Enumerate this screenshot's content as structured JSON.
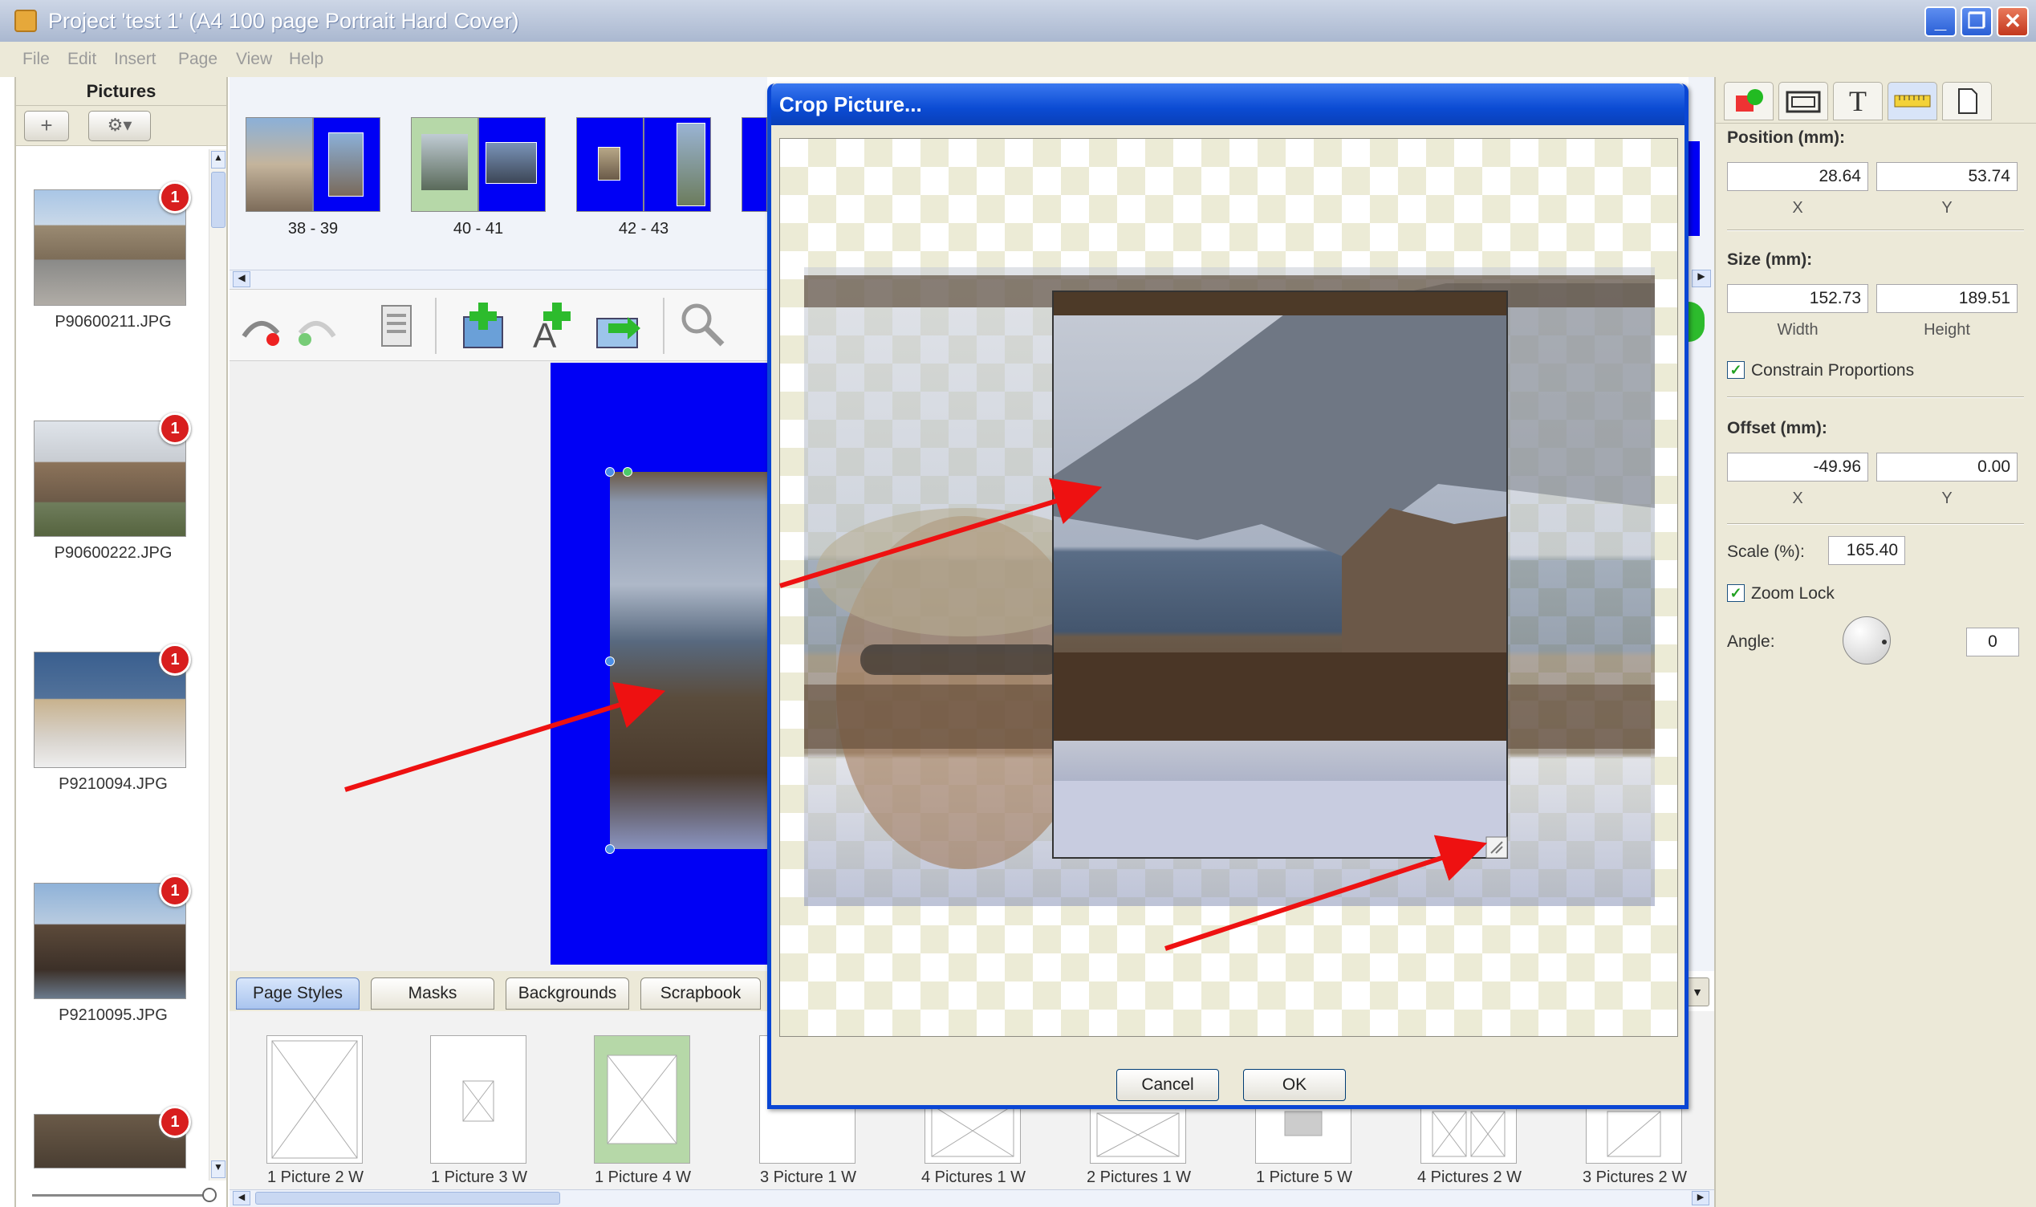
{
  "window": {
    "title": "Project 'test 1' (A4 100 page Portrait Hard Cover)"
  },
  "menu": [
    "File",
    "Edit",
    "Insert",
    "Page",
    "View",
    "Help"
  ],
  "pictures_panel": {
    "title": "Pictures",
    "items": [
      {
        "name": "P90600211.JPG",
        "badge": "1"
      },
      {
        "name": "P90600222.JPG",
        "badge": "1"
      },
      {
        "name": "P9210094.JPG",
        "badge": "1"
      },
      {
        "name": "P9210095.JPG",
        "badge": "1"
      },
      {
        "name": "",
        "badge": "1"
      }
    ]
  },
  "spreads": [
    "38 - 39",
    "40 - 41",
    "42 - 43"
  ],
  "bottom_tabs": [
    "Page Styles",
    "Masks",
    "Backgrounds",
    "Scrapbook"
  ],
  "layouts": [
    "1 Picture 2 W",
    "1 Picture 3 W",
    "1 Picture 4 W",
    "3 Picture 1 W",
    "4 Pictures 1 W",
    "2 Pictures 1 W",
    "1 Picture 5 W",
    "4 Pictures 2 W",
    "3 Pictures 2 W"
  ],
  "dialog": {
    "title": "Crop Picture...",
    "cancel": "Cancel",
    "ok": "OK"
  },
  "properties": {
    "position_label": "Position (mm):",
    "position_x": "28.64",
    "position_y": "53.74",
    "x_caption": "X",
    "y_caption": "Y",
    "size_label": "Size (mm):",
    "width": "152.73",
    "height": "189.51",
    "width_caption": "Width",
    "height_caption": "Height",
    "constrain_label": "Constrain Proportions",
    "constrain_checked": true,
    "offset_label": "Offset (mm):",
    "offset_x": "-49.96",
    "offset_y": "0.00",
    "scale_label": "Scale (%):",
    "scale": "165.40",
    "zoom_lock_label": "Zoom Lock",
    "zoom_lock_checked": true,
    "angle_label": "Angle:",
    "angle": "0"
  },
  "colors": {
    "accent_blue": "#0a46d4",
    "page_blue": "#0000f5",
    "arrow_red": "#ee1111",
    "badge_red": "#d81e1e"
  }
}
